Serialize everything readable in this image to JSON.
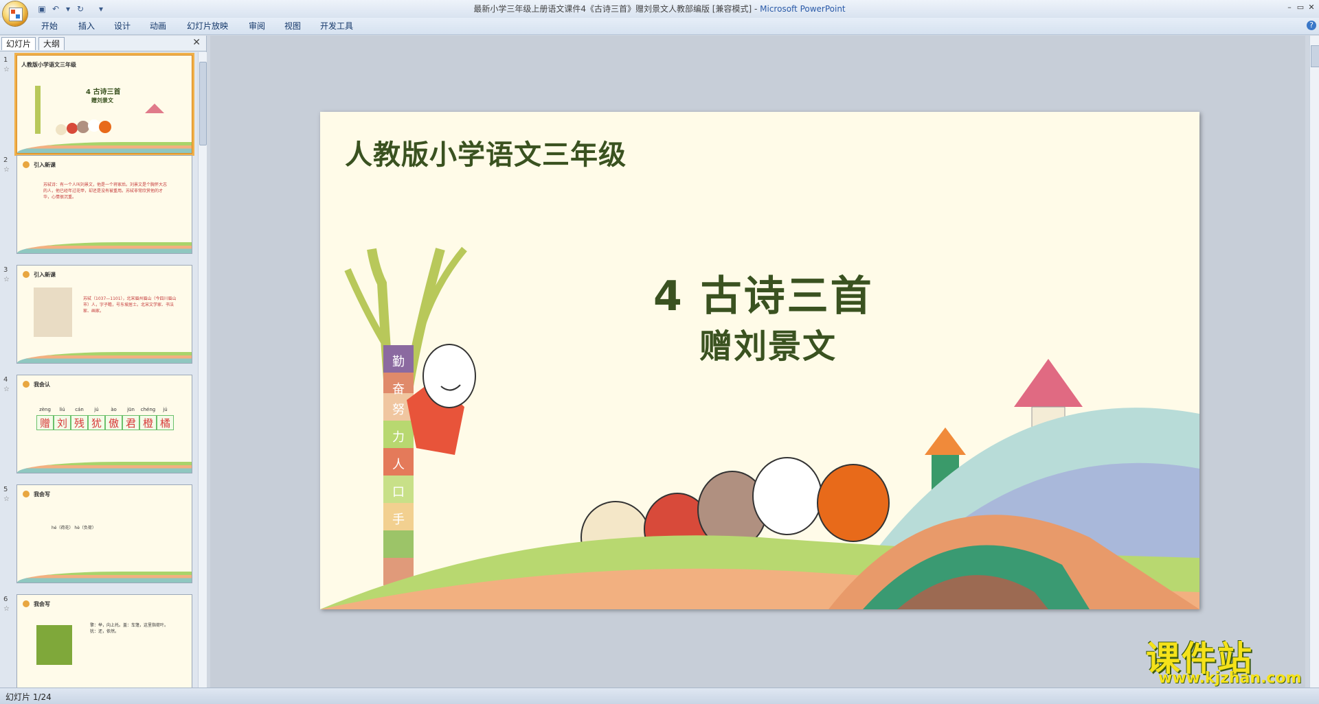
{
  "window": {
    "title": "最新小学三年级上册语文课件4《古诗三首》赠刘景文人教部编版 [兼容模式] -",
    "app_name": "Microsoft PowerPoint"
  },
  "ribbon": {
    "tabs": [
      "开始",
      "插入",
      "设计",
      "动画",
      "幻灯片放映",
      "审阅",
      "视图",
      "开发工具"
    ]
  },
  "left_pane": {
    "tabs": [
      "幻灯片",
      "大纲"
    ],
    "thumbnails": [
      {
        "num": "1",
        "heading": "人教版小学语文三年级",
        "title": "4  古诗三首",
        "subtitle": "赠刘景文"
      },
      {
        "num": "2",
        "heading": "引入新课",
        "body": "苏轼诗：有一个人叫刘景文，他是一个将家后。刘景文是个胸怀大志的人，他已经年过花甲，却还是没有被重用。苏轼非常欣赏他的才华，心情很沉重。"
      },
      {
        "num": "3",
        "heading": "引入新课",
        "body": "苏轼（1037—1101），北宋眉州眉山（今四川眉山市）人，字子瞻，号东坡居士。北宋文学家、书法家、画家。"
      },
      {
        "num": "4",
        "heading": "我会认",
        "pinyin": [
          "zèng",
          "liú",
          "cán",
          "jú",
          "ào",
          "jūn",
          "chéng",
          "jú"
        ],
        "chars": [
          "赠",
          "刘",
          "残",
          "犹",
          "傲",
          "君",
          "橙",
          "橘"
        ]
      },
      {
        "num": "5",
        "heading": "我会写",
        "body": "hé（荷花）  hè（负荷）"
      },
      {
        "num": "6",
        "heading": "我会写",
        "body": "擎：举，向上托。盖：车篷，这里指荷叶。犹：还，依然。"
      }
    ]
  },
  "slide": {
    "heading": "人教版小学语文三年级",
    "title": "4  古诗三首",
    "subtitle": "赠刘景文",
    "tree_chars": [
      "勤",
      "奋",
      "努",
      "力",
      "人",
      "口",
      "手"
    ]
  },
  "status": {
    "slide_indicator": "幻灯片 1/24"
  },
  "watermark": {
    "text": "课件站",
    "url": "www.kjzhan.com"
  },
  "colors": {
    "heading_green": "#3a5220",
    "slide_bg": "#fffbe8",
    "selection": "#f0b04a"
  }
}
